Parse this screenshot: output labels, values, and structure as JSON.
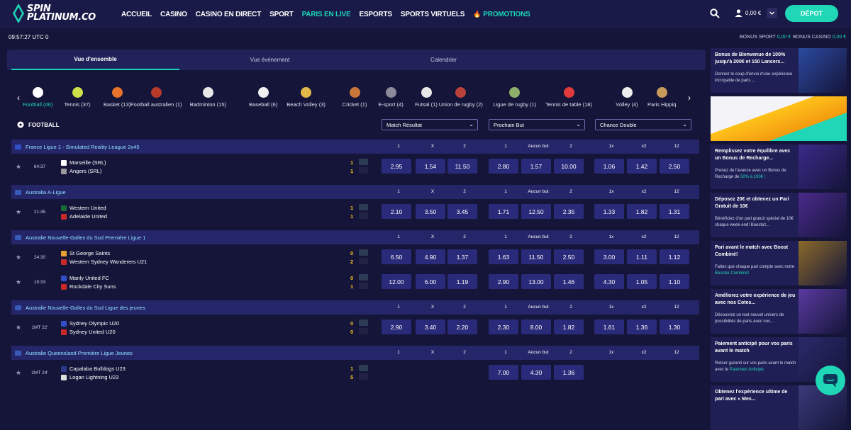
{
  "logo": {
    "line1": "SPIN",
    "line2": "PLATINUM.CO"
  },
  "nav": [
    "ACCUEIL",
    "CASINO",
    "CASINO EN DIRECT",
    "SPORT",
    "PARIS EN LIVE",
    "ESPORTS",
    "SPORTS VIRTUELS",
    "PROMOTIONS"
  ],
  "nav_active_index": 4,
  "header": {
    "balance": "0,00 €",
    "deposit_label": "DÉPOT",
    "clock": "09:57:27 UTC 0",
    "bonus_sport_label": "BONUS SPORT",
    "bonus_sport_value": "0,00 €",
    "bonus_casino_label": "BONUS CASINO",
    "bonus_casino_value": "0,00 €"
  },
  "tabs": [
    "Vue d'ensemble",
    "Vue événement",
    "Calendrier"
  ],
  "sports": [
    {
      "label": "Football (46)",
      "icon": "football-icon",
      "color": "#ffffff"
    },
    {
      "label": "Tennis (37)",
      "icon": "tennis-icon",
      "color": "#cde04a"
    },
    {
      "label": "Basket (13)",
      "icon": "basketball-icon",
      "color": "#e8732a"
    },
    {
      "label": "Football australien (1)",
      "icon": "aussie-football-icon",
      "color": "#b93a2a"
    },
    {
      "label": "Badminton (15)",
      "icon": "shuttlecock-icon",
      "color": "#e8e8e8"
    },
    {
      "label": "Baseball (6)",
      "icon": "baseball-icon",
      "color": "#f0f0f0"
    },
    {
      "label": "Beach Volley (3)",
      "icon": "beach-volley-icon",
      "color": "#e2b84a"
    },
    {
      "label": "Cricket (1)",
      "icon": "cricket-icon",
      "color": "#c8763a"
    },
    {
      "label": "E-sport (4)",
      "icon": "gamepad-icon",
      "color": "#8a8a9a"
    },
    {
      "label": "Futsal (1)",
      "icon": "futsal-icon",
      "color": "#e8e8e8"
    },
    {
      "label": "Union de rugby (2)",
      "icon": "rugby-icon",
      "color": "#b9413a"
    },
    {
      "label": "Ligue de rugby (1)",
      "icon": "rugby-league-icon",
      "color": "#8fb06a"
    },
    {
      "label": "Tennis de table (18)",
      "icon": "table-tennis-icon",
      "color": "#e23a3a"
    },
    {
      "label": "Volley (4)",
      "icon": "volleyball-icon",
      "color": "#eeeeee"
    },
    {
      "label": "Paris Hippiq",
      "icon": "horse-icon",
      "color": "#c89a5a"
    }
  ],
  "section_title": "FOOTBALL",
  "markets": [
    "Match Résultat",
    "Prochain But",
    "Chance Double"
  ],
  "col_headers": [
    [
      "1",
      "X",
      "2"
    ],
    [
      "1",
      "Aucun but",
      "2"
    ],
    [
      "1x",
      "x2",
      "12"
    ]
  ],
  "leagues": [
    {
      "name": "France Ligue 1 - Simulated Reality League 2x45",
      "flag": "#3050c8",
      "matches": [
        {
          "time": "64:37",
          "home": "Marseille (SRL)",
          "away": "Angers (SRL)",
          "hs": "1",
          "as": "1",
          "home_color": "#ffffff",
          "away_color": "#999999",
          "odds": [
            [
              "2.95",
              "1.54",
              "11.50"
            ],
            [
              "2.80",
              "1.57",
              "10.00"
            ],
            [
              "1.06",
              "1.42",
              "2.50"
            ]
          ]
        }
      ]
    },
    {
      "name": "Australia A-Ligue",
      "flag": "#3a5ab8",
      "matches": [
        {
          "time": "21:45",
          "home": "Western United",
          "away": "Adelaide United",
          "hs": "1",
          "as": "1",
          "home_color": "#1a6a3a",
          "away_color": "#c82a2a",
          "odds": [
            [
              "2.10",
              "3.50",
              "3.45"
            ],
            [
              "1.71",
              "12.50",
              "2.35"
            ],
            [
              "1.33",
              "1.82",
              "1.31"
            ]
          ]
        }
      ]
    },
    {
      "name": "Australie Nouvelle-Galles du Sud Première Ligue 1",
      "flag": "#3a5ab8",
      "matches": [
        {
          "time": "24:30",
          "home": "St George Saints",
          "away": "Western Sydney Wanderers U21",
          "hs": "0",
          "as": "2",
          "home_color": "#e8a030",
          "away_color": "#c82a2a",
          "odds": [
            [
              "6.50",
              "4.90",
              "1.37"
            ],
            [
              "1.63",
              "11.50",
              "2.50"
            ],
            [
              "3.00",
              "1.11",
              "1.12"
            ]
          ]
        },
        {
          "time": "15:33",
          "home": "Manly United FC",
          "away": "Rockdale City Suns",
          "hs": "0",
          "as": "1",
          "home_color": "#3050c8",
          "away_color": "#c82a2a",
          "odds": [
            [
              "12.00",
              "6.00",
              "1.19"
            ],
            [
              "2.90",
              "13.00",
              "1.46"
            ],
            [
              "4.30",
              "1.05",
              "1.10"
            ]
          ]
        }
      ]
    },
    {
      "name": "Australie Nouvelle-Galles du Sud Ligue des jeunes",
      "flag": "#3a5ab8",
      "matches": [
        {
          "time": "1MT 22'",
          "home": "Sydney Olympic U20",
          "away": "Sydney United U20",
          "hs": "0",
          "as": "0",
          "home_color": "#3050c8",
          "away_color": "#c82a2a",
          "odds": [
            [
              "2.90",
              "3.40",
              "2.20"
            ],
            [
              "2.30",
              "8.00",
              "1.82"
            ],
            [
              "1.61",
              "1.36",
              "1.30"
            ]
          ]
        }
      ]
    },
    {
      "name": "Australie Queensland Première Ligue Jeunes",
      "flag": "#3a5ab8",
      "matches": [
        {
          "time": "2MT 24'",
          "home": "Capalaba Bulldogs U23",
          "away": "Logan Lightning U23",
          "hs": "1",
          "as": "5",
          "home_color": "#2a3a8a",
          "away_color": "#dddddd",
          "odds": [
            [],
            [
              "7.00",
              "4.30",
              "1.36"
            ],
            []
          ]
        }
      ]
    }
  ],
  "promos": [
    {
      "title": "Bonus de Bienvenue de 100% jusqu'à 200€ et 150 Lancers...",
      "desc": "Donnez le coup d'envoi d'une expérience incroyable de paris ...",
      "highlight": ""
    },
    {
      "title": "",
      "desc": "",
      "highlight": ""
    },
    {
      "title": "Remplissez votre équilibre avec un Bonus de Recharge...",
      "desc": "Prenez de l'avance avec un Bonus de Recharge de ",
      "highlight": "50% à 100€ !"
    },
    {
      "title": "Déposez 20€ et obtenez un Pari Gratuit de 10€",
      "desc": "Bénéficiez d'un pari gratuit spécial de 10€ chaque week-end! Boostez...",
      "highlight": ""
    },
    {
      "title": "Pari avant le match avec Boost Combiné!",
      "desc": "Faites que chaque pari compte avec notre ",
      "highlight": "Booster Combiné!"
    },
    {
      "title": "Améliorez votre expérience de jeu avec nos Cotes...",
      "desc": "Découvrez un tout nouvel univers de possibilités de paris avec nos...",
      "highlight": ""
    },
    {
      "title": "Paiement anticipé pour vos paris avant le match",
      "desc": "Retour garanti sur vos paris avant le match avec le ",
      "highlight": "Paiement Anticipé."
    },
    {
      "title": "Obtenez l'expérience ultime de pari avec « Mes...",
      "desc": "",
      "highlight": ""
    }
  ]
}
